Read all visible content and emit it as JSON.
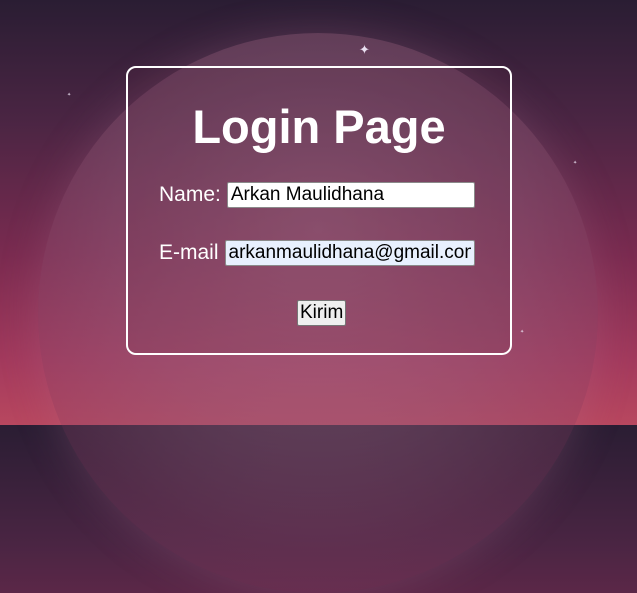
{
  "page": {
    "title": "Login Page"
  },
  "form": {
    "name_label": "Name:",
    "name_value": "Arkan Maulidhana",
    "email_label": "E-mail",
    "email_value": "arkanmaulidhana@gmail.com",
    "submit_label": "Kirim"
  },
  "background": {
    "star_glyph": "✦",
    "colors": {
      "top": "#2a1d33",
      "middle": "#7a2b50",
      "bottom": "#b8475f"
    }
  },
  "theme": {
    "card_border": "#ffffff",
    "text": "#ffffff",
    "email_autofill_bg": "#e8f0fe"
  }
}
